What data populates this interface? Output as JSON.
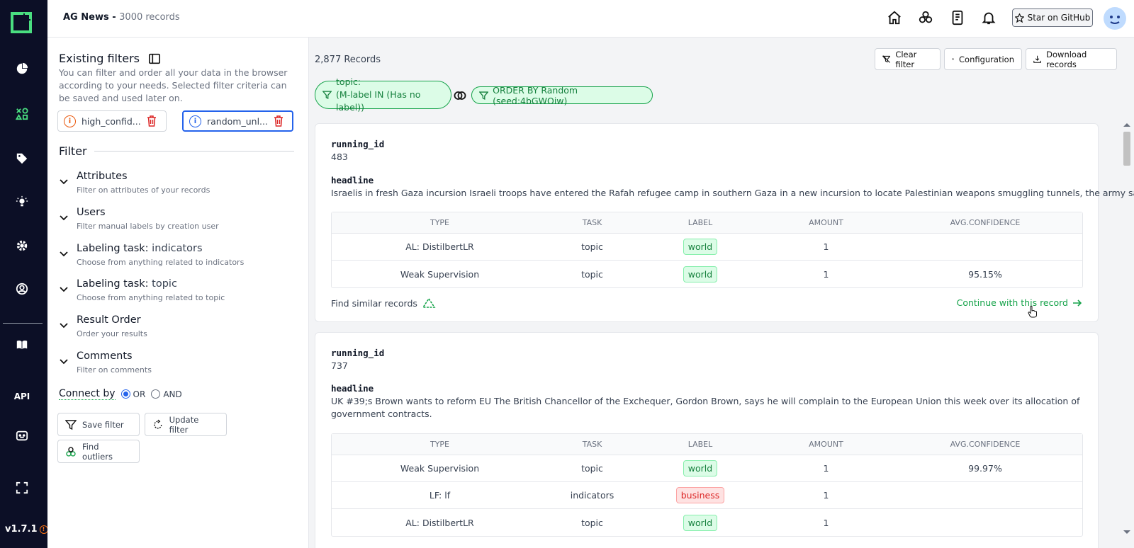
{
  "app": {
    "version": "v1.7.1",
    "nav_api_label": "API"
  },
  "header": {
    "project_name": "AG News - ",
    "record_count_label": "3000 records",
    "github_button": "Star on GitHub"
  },
  "panel": {
    "existing_filters_title": "Existing filters",
    "description": "You can filter and order all your data in the browser according to your needs. Selected filter criteria can be saved and used later on.",
    "saved_filters": [
      {
        "name": "high_confid...",
        "icon_color": "#ea580c"
      },
      {
        "name": "random_unl...",
        "icon_color": "#2563eb"
      }
    ],
    "filter_title": "Filter",
    "sections": [
      {
        "title": "Attributes",
        "sub": "",
        "desc": "Filter on attributes of your records"
      },
      {
        "title": "Users",
        "sub": "",
        "desc": "Filter manual labels by creation user"
      },
      {
        "title": "Labeling task: ",
        "sub": "indicators",
        "desc": "Choose from anything related to indicators"
      },
      {
        "title": "Labeling task: ",
        "sub": "topic",
        "desc": "Choose from anything related to topic"
      },
      {
        "title": "Result Order",
        "sub": "",
        "desc": "Order your results"
      },
      {
        "title": "Comments",
        "sub": "",
        "desc": "Filter on comments"
      }
    ],
    "connect_by_label": "Connect by",
    "connect_options": [
      "OR",
      "AND"
    ],
    "connect_selected": "OR",
    "buttons": {
      "save_filter": "Save filter",
      "update_filter": "Update filter",
      "find_outliers": "Find outliers"
    }
  },
  "main": {
    "records_count": "2,877 Records",
    "buttons": {
      "clear_filter": "Clear filter",
      "configuration": "Configuration",
      "download_records": "Download records"
    },
    "chips": {
      "topic_line1": "topic:",
      "topic_line2": "(M-label IN (Has no label))",
      "order": "ORDER BY Random (seed:4bGWOiw)"
    },
    "table_headers": [
      "TYPE",
      "TASK",
      "LABEL",
      "AMOUNT",
      "AVG.CONFIDENCE"
    ],
    "records": [
      {
        "running_id_label": "running_id",
        "running_id": "483",
        "headline_label": "headline",
        "headline": "Israelis in fresh Gaza incursion Israeli troops have entered the Rafah refugee camp in southern Gaza in a new incursion to locate Palestinian weapons smuggling tunnels, the army says.",
        "rows": [
          {
            "type": "AL: DistilbertLR",
            "task": "topic",
            "label": "world",
            "amount": "1",
            "confidence": ""
          },
          {
            "type": "Weak Supervision",
            "task": "topic",
            "label": "world",
            "amount": "1",
            "confidence": "95.15%"
          }
        ],
        "find_similar": "Find similar records",
        "continue": "Continue with this record"
      },
      {
        "running_id_label": "running_id",
        "running_id": "737",
        "headline_label": "headline",
        "headline": "UK #39;s Brown wants to reform EU The British Chancellor of the Exchequer, Gordon Brown, says he will complain to the European Union this week over its allocation of government contracts.",
        "rows": [
          {
            "type": "Weak Supervision",
            "task": "topic",
            "label": "world",
            "amount": "1",
            "confidence": "99.97%"
          },
          {
            "type": "LF: lf",
            "task": "indicators",
            "label": "business",
            "amount": "1",
            "confidence": ""
          },
          {
            "type": "AL: DistilbertLR",
            "task": "topic",
            "label": "world",
            "amount": "1",
            "confidence": ""
          }
        ]
      }
    ]
  },
  "colors": {
    "nav_bg": "#0c0f26",
    "accent_green": "#16a34a",
    "accent_blue": "#2563eb"
  }
}
